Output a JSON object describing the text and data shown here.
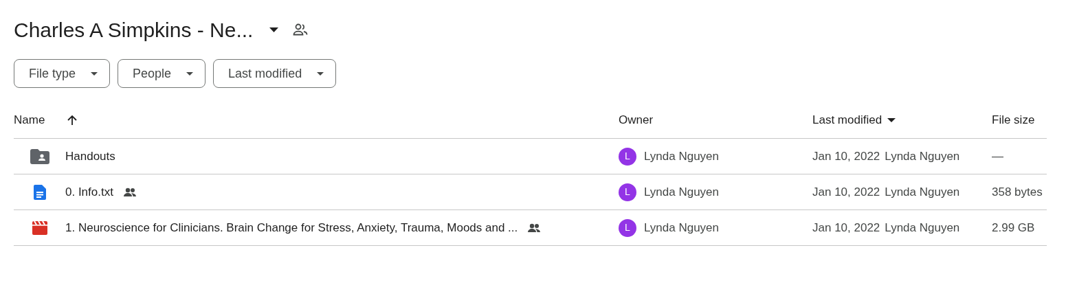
{
  "title": "Charles A Simpkins - Ne...",
  "filters": [
    "File type",
    "People",
    "Last modified"
  ],
  "table": {
    "columns": [
      {
        "label": "Name",
        "sorted": true,
        "ascending": true
      },
      {
        "label": "Owner",
        "sorted": false
      },
      {
        "label": "Last modified",
        "sorted": true,
        "ascending": false
      },
      {
        "label": "File size",
        "sorted": false
      }
    ],
    "rows": [
      {
        "kind": "folder",
        "name": "Handouts",
        "shared": false,
        "owner": {
          "initial": "L",
          "name": "Lynda Nguyen",
          "color": "#9334e6"
        },
        "date": "Jan 10, 2022",
        "modified_by": "Lynda Nguyen",
        "size": "—"
      },
      {
        "kind": "doc",
        "name": "0. Info.txt",
        "shared": true,
        "owner": {
          "initial": "L",
          "name": "Lynda Nguyen",
          "color": "#9334e6"
        },
        "date": "Jan 10, 2022",
        "modified_by": "Lynda Nguyen",
        "size": "358 bytes"
      },
      {
        "kind": "video",
        "name": "1. Neuroscience for Clinicians.  Brain Change for Stress, Anxiety, Trauma, Moods and ...",
        "shared": true,
        "owner": {
          "initial": "L",
          "name": "Lynda Nguyen",
          "color": "#9334e6"
        },
        "date": "Jan 10, 2022",
        "modified_by": "Lynda Nguyen",
        "size": "2.99 GB"
      }
    ]
  }
}
